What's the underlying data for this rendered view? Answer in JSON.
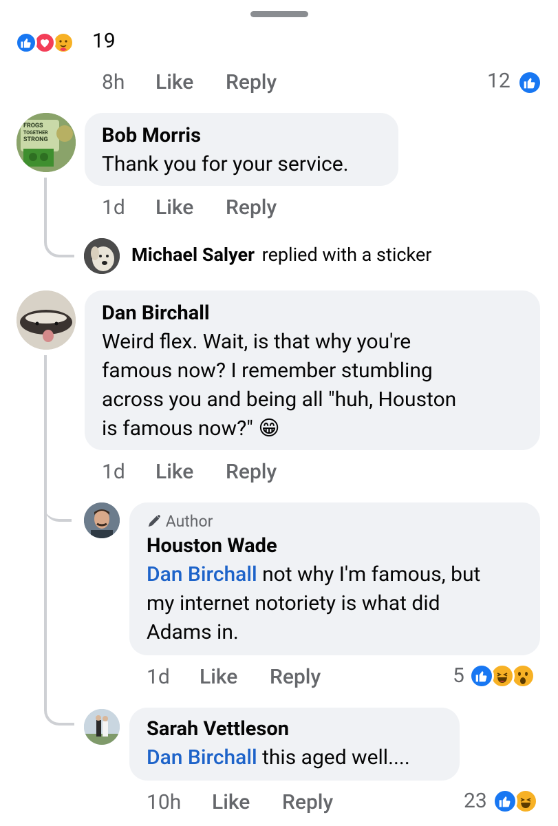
{
  "top_reactions": {
    "count": "19",
    "icons": [
      "like-icon",
      "love-icon",
      "care-icon"
    ]
  },
  "parent_actions": {
    "time": "8h",
    "like_label": "Like",
    "reply_label": "Reply",
    "reaction_count": "12",
    "reaction_icons": [
      "like-icon"
    ]
  },
  "comments": [
    {
      "author": "Bob Morris",
      "text": "Thank you for your service.",
      "time": "1d",
      "like_label": "Like",
      "reply_label": "Reply",
      "avatar_text": [
        "FROGS",
        "TOGETHER",
        "STRONG"
      ],
      "sticker_reply": {
        "author": "Michael Salyer",
        "text": "replied with a sticker"
      }
    },
    {
      "author": "Dan Birchall",
      "text_lines": [
        "Weird flex.  Wait, is that why you're",
        "famous now?  I remember stumbling",
        "across you and being all \"huh, Houston",
        "is famous now?\""
      ],
      "emoji": "😁",
      "time": "1d",
      "like_label": "Like",
      "reply_label": "Reply",
      "replies": [
        {
          "author_badge": "Author",
          "author": "Houston Wade",
          "mention": "Dan Birchall",
          "text_lines": [
            " not why I'm famous, but",
            "my internet notoriety is what did",
            "Adams in."
          ],
          "time": "1d",
          "like_label": "Like",
          "reply_label": "Reply",
          "reaction_count": "5",
          "reaction_icons": [
            "like-icon",
            "haha-icon",
            "wow-icon"
          ]
        },
        {
          "author": "Sarah Vettleson",
          "mention": "Dan Birchall",
          "text": " this aged well....",
          "time": "10h",
          "like_label": "Like",
          "reply_label": "Reply",
          "reaction_count": "23",
          "reaction_icons": [
            "like-icon",
            "haha-icon"
          ]
        }
      ]
    }
  ],
  "colors": {
    "like": "#1877f2",
    "love": "#f33e58",
    "emoji_yellow": "#f7b125",
    "bubble": "#f0f2f5",
    "meta_text": "#65676b",
    "mention": "#1d63c9"
  }
}
